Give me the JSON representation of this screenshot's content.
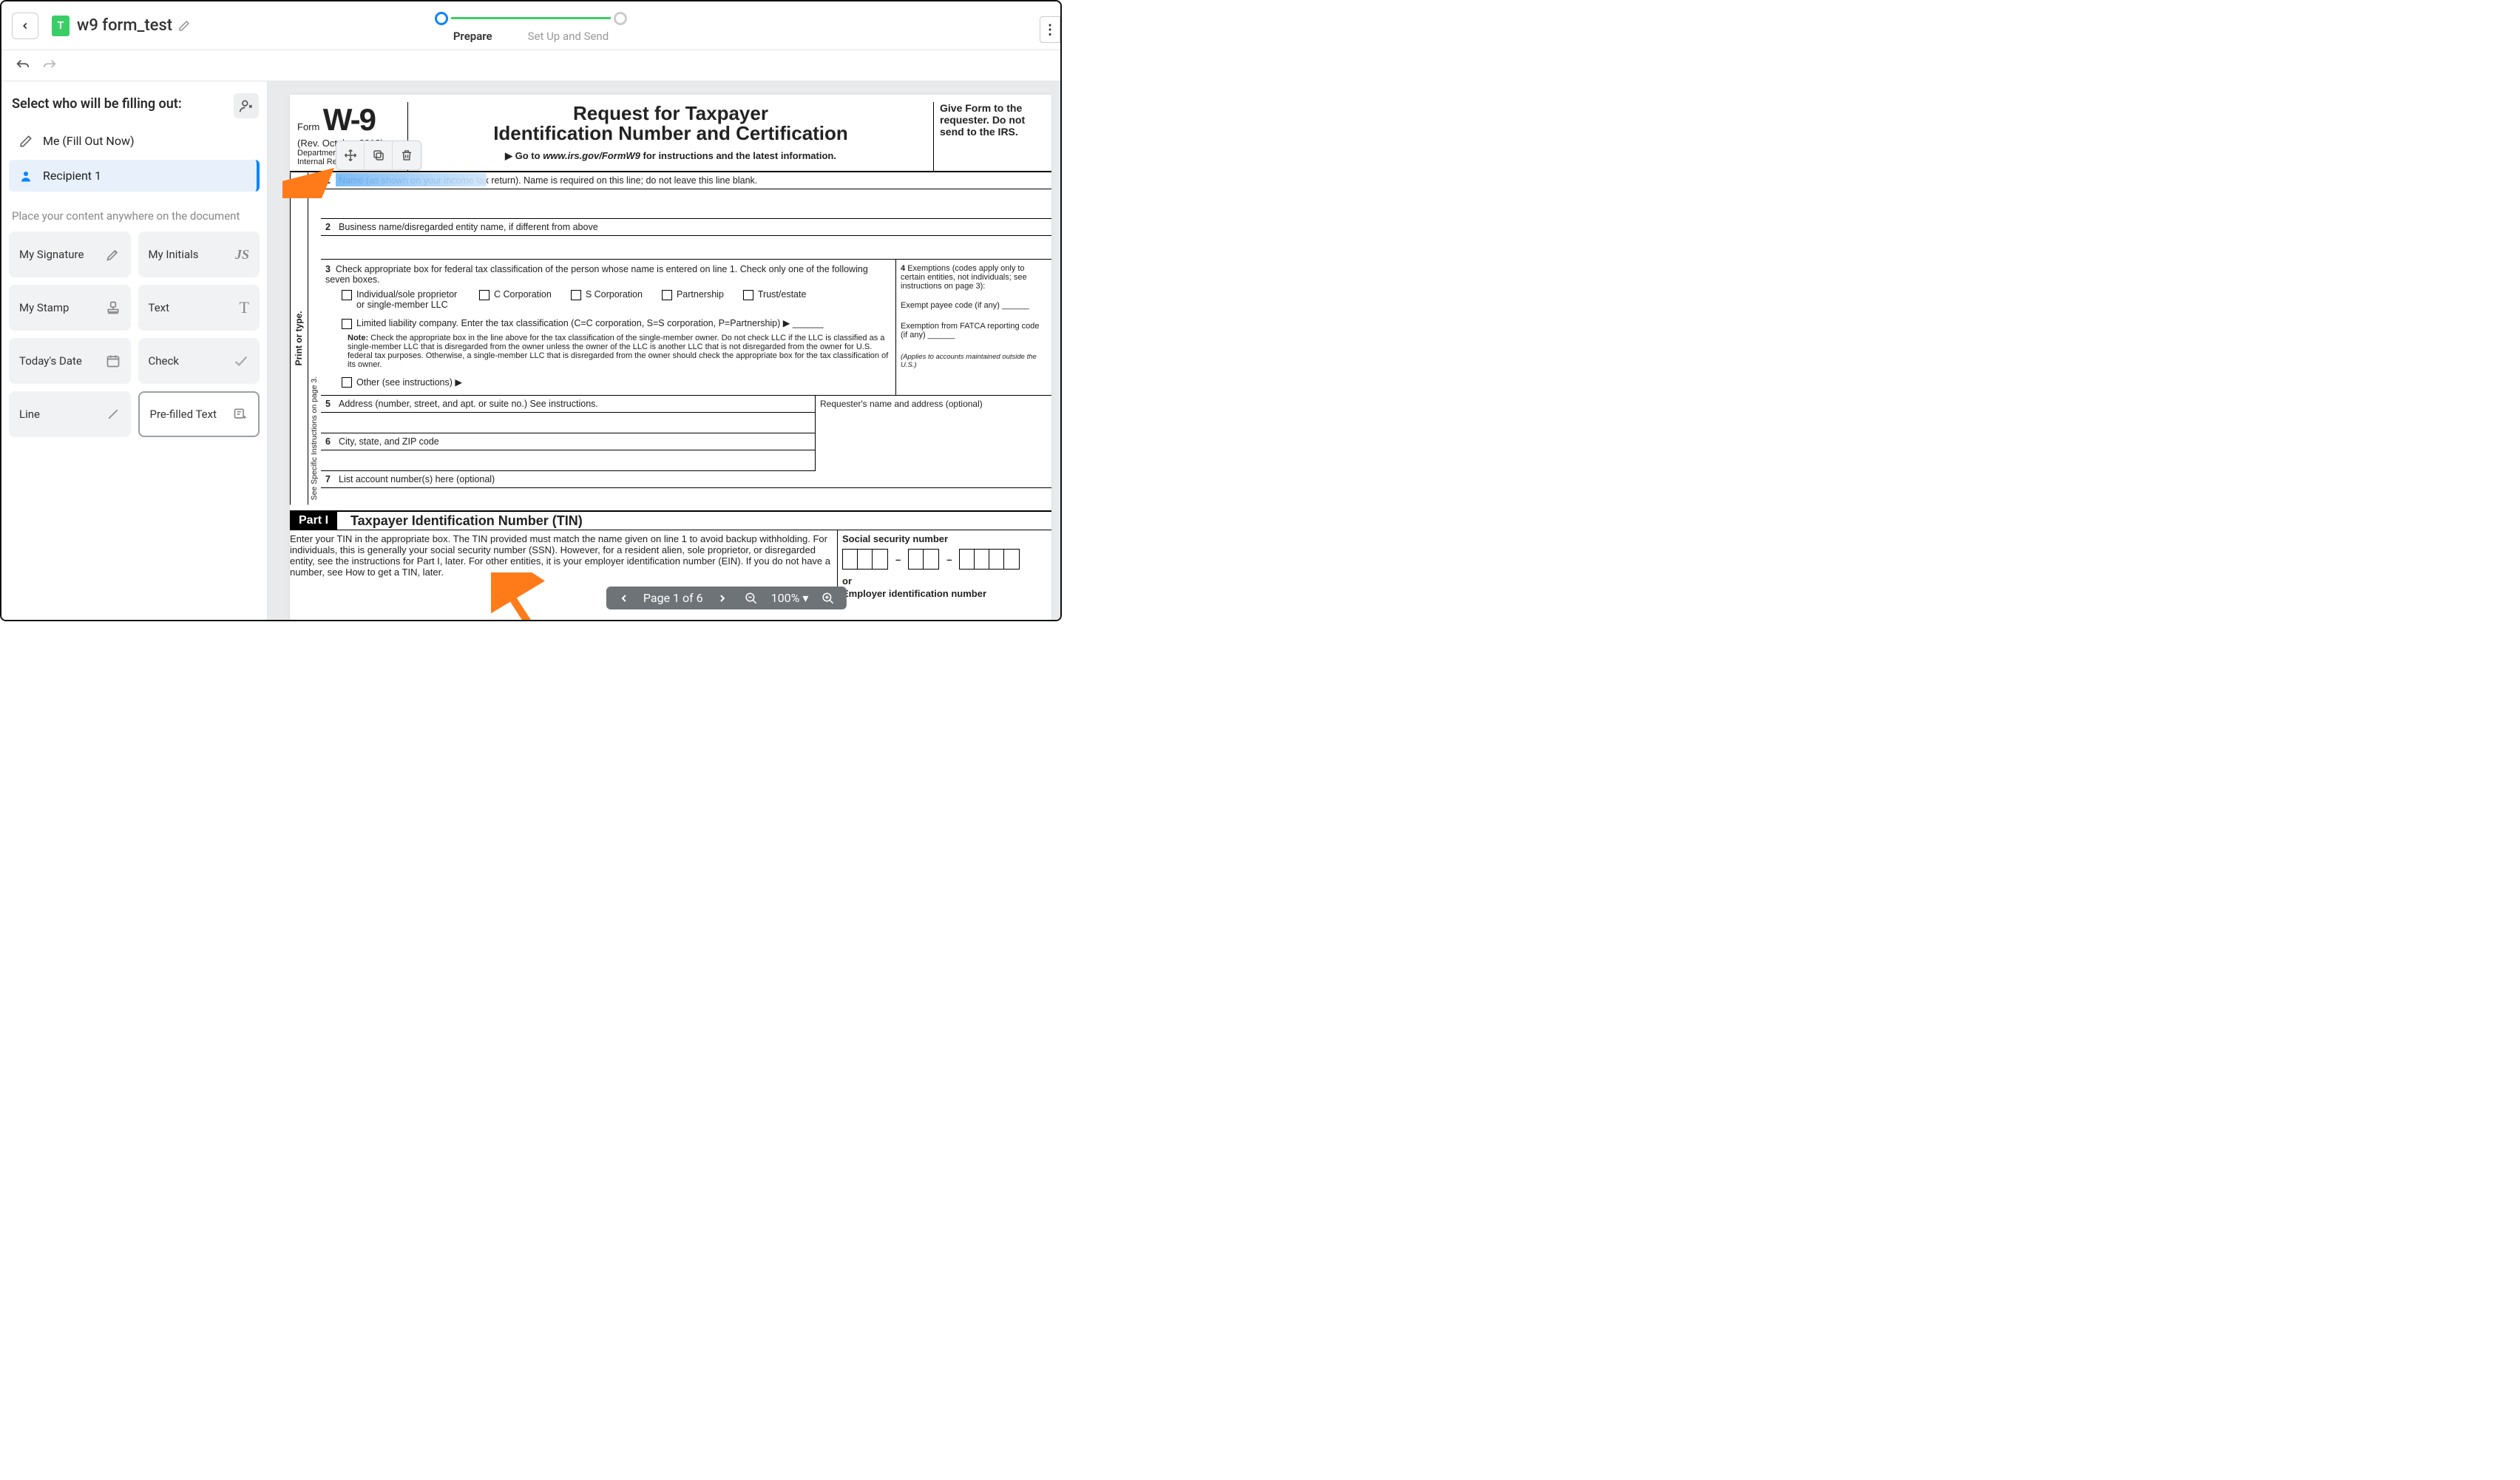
{
  "header": {
    "doc_title": "w9 form_test",
    "steps": {
      "step1": "Prepare",
      "step2": "Set Up and Send"
    }
  },
  "sidebar": {
    "heading": "Select who will be filling out:",
    "me_label": "Me (Fill Out Now)",
    "recipient_label": "Recipient 1",
    "place_heading": "Place your content anywhere on the document",
    "tools": {
      "signature": "My Signature",
      "initials": "My Initials",
      "initials_sample": "JS",
      "stamp": "My Stamp",
      "text": "Text",
      "date": "Today's Date",
      "check": "Check",
      "line": "Line",
      "prefilled": "Pre-filled Text"
    }
  },
  "form": {
    "form_word": "Form",
    "w9": "W-9",
    "rev": "(Rev. October 2018)",
    "dept": "Department of the Treasury",
    "irs": "Internal Revenue Service",
    "title1": "Request for Taxpayer",
    "title2": "Identification Number and Certification",
    "go_prefix": "▶ Go to ",
    "go_url": "www.irs.gov/FormW9",
    "go_suffix": " for instructions and the latest information.",
    "right1": "Give Form to the requester. Do not send to the IRS.",
    "rot_main": "Print or type.",
    "rot_sub": "See Specific Instructions on page 3.",
    "l1": "Name (as shown on your income tax return). Name is required on this line; do not leave this line blank.",
    "l2": "Business name/disregarded entity name, if different from above",
    "l3_intro": "Check appropriate box for federal tax classification of the person whose name is entered on line 1. Check only one of the following seven boxes.",
    "c_ind": "Individual/sole proprietor or single-member LLC",
    "c_ccorp": "C Corporation",
    "c_scorp": "S Corporation",
    "c_part": "Partnership",
    "c_trust": "Trust/estate",
    "c_llc": "Limited liability company. Enter the tax classification (C=C corporation, S=S corporation, P=Partnership) ▶",
    "note_label": "Note:",
    "note_body": " Check the appropriate box in the line above for the tax classification of the single-member owner.  Do not check LLC if the LLC is classified as a single-member LLC that is disregarded from the owner unless the owner of the LLC is another LLC that is not disregarded from the owner for U.S. federal tax purposes. Otherwise, a single-member LLC that is disregarded from the owner should check the appropriate box for the tax classification of its owner.",
    "c_other": "Other (see instructions) ▶",
    "l4_intro": "Exemptions (codes apply only to certain entities, not individuals; see instructions on page 3):",
    "l4_payee": "Exempt payee code (if any)",
    "l4_fatca": "Exemption from FATCA reporting code (if any)",
    "l4_applies": "(Applies to accounts maintained outside the U.S.)",
    "l5": "Address (number, street, and apt. or suite no.) See instructions.",
    "l5r": "Requester's name and address (optional)",
    "l6": "City, state, and ZIP code",
    "l7": "List account number(s) here (optional)",
    "part1": "Part I",
    "part1_title": "Taxpayer Identification Number (TIN)",
    "tin_body": "Enter your TIN in the appropriate box. The TIN provided must match the name given on line 1 to avoid backup withholding. For individuals, this is generally your social security number (SSN). However, for a resident alien, sole proprietor, or disregarded entity, see the instructions for Part I, later. For other entities, it is your employer identification number (EIN). If you do not have a number, see How to get a TIN, later.",
    "ssn_label": "Social security number",
    "or": "or",
    "ein_label": "Employer identification number"
  },
  "nav": {
    "page_text": "Page 1 of 6",
    "zoom": "100%"
  }
}
